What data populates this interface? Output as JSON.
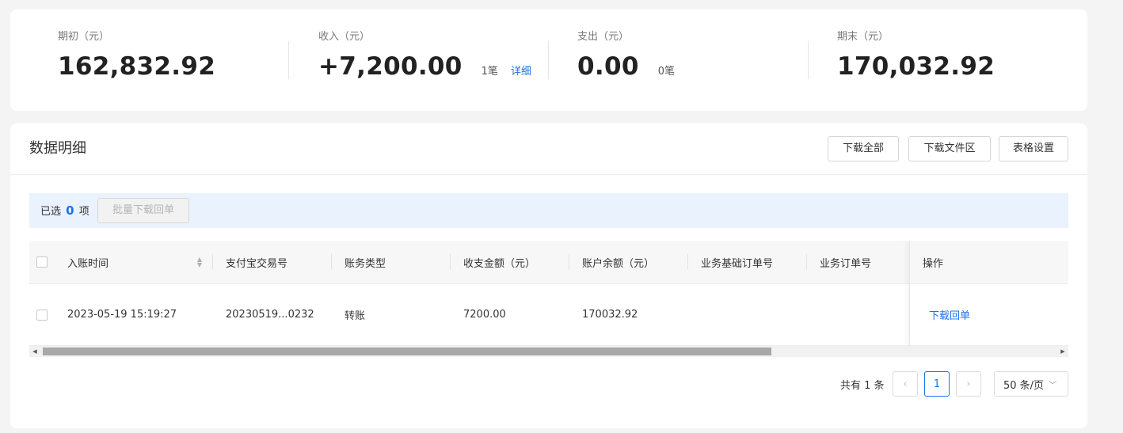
{
  "summary": {
    "opening": {
      "label": "期初（元）",
      "value": "162,832.92"
    },
    "income": {
      "label": "收入（元）",
      "value": "+7,200.00",
      "count": "1笔",
      "link": "详细"
    },
    "expense": {
      "label": "支出（元）",
      "value": "0.00",
      "count": "0笔"
    },
    "closing": {
      "label": "期末（元）",
      "value": "170,032.92"
    }
  },
  "details": {
    "title": "数据明细",
    "buttons": {
      "download_all": "下载全部",
      "download_files": "下载文件区",
      "table_settings": "表格设置"
    },
    "selection": {
      "prefix": "已选",
      "count": "0",
      "suffix": "项",
      "batch_button": "批量下载回单"
    },
    "columns": [
      "入账时间",
      "支付宝交易号",
      "账务类型",
      "收支金额（元）",
      "账户余额（元）",
      "业务基础订单号",
      "业务订单号",
      "操作"
    ],
    "rows": [
      {
        "time": "2023-05-19 15:19:27",
        "trade_no": "20230519...0232",
        "type": "转账",
        "amount": "7200.00",
        "balance": "170032.92",
        "base_order": "",
        "order": "",
        "action": "下载回单"
      }
    ],
    "scrollbar": {
      "position_fraction": 0.0,
      "visible_fraction": 0.72
    },
    "pagination": {
      "total": "共有 1 条",
      "current_page": "1",
      "page_size": "50 条/页"
    }
  },
  "colors": {
    "accent": "#1a73e8",
    "selection_bg": "#eaf2fd"
  }
}
